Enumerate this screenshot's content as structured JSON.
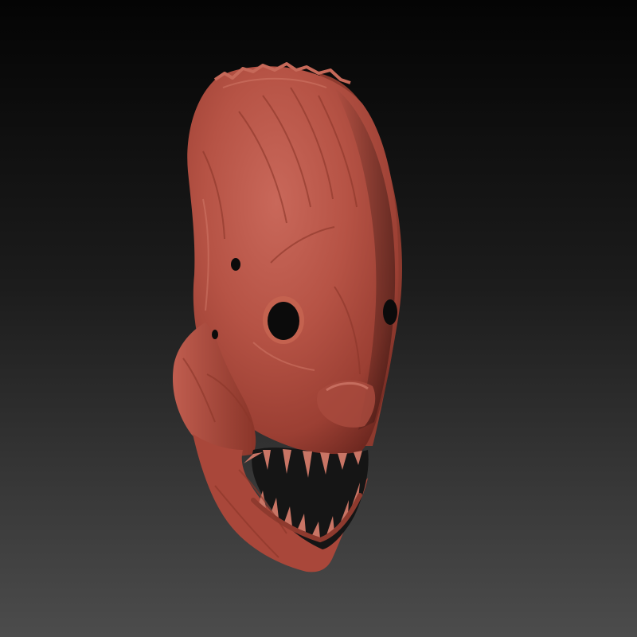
{
  "scene": {
    "subject": "mask-sculpt",
    "material_color": "#b5503f",
    "background_top": "#050505",
    "background_bottom": "#4a4a4a"
  }
}
